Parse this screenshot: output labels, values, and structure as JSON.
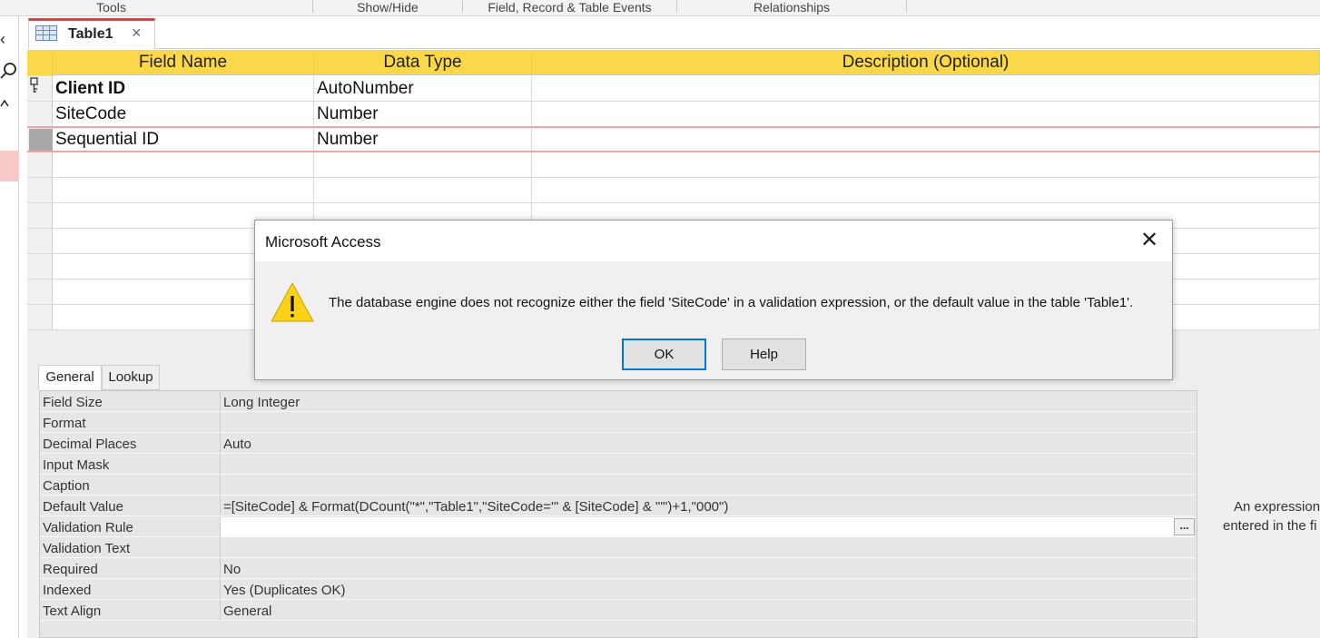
{
  "ribbon": {
    "groups": [
      "Tools",
      "Show/Hide",
      "Field, Record & Table Events",
      "Relationships"
    ]
  },
  "document_tab": {
    "label": "Table1",
    "close": "×"
  },
  "grid": {
    "headers": [
      "Field Name",
      "Data Type",
      "Description (Optional)"
    ],
    "rows": [
      {
        "field": "Client ID",
        "type": "AutoNumber",
        "description": "",
        "primary_key": true
      },
      {
        "field": "SiteCode",
        "type": "Number",
        "description": ""
      },
      {
        "field": "Sequential ID",
        "type": "Number",
        "description": "",
        "selected": true
      }
    ]
  },
  "properties": {
    "tabs": [
      "General",
      "Lookup"
    ],
    "active_tab": "General",
    "rows": [
      {
        "label": "Field Size",
        "value": "Long Integer"
      },
      {
        "label": "Format",
        "value": ""
      },
      {
        "label": "Decimal Places",
        "value": "Auto"
      },
      {
        "label": "Input Mask",
        "value": ""
      },
      {
        "label": "Caption",
        "value": ""
      },
      {
        "label": "Default Value",
        "value": "=[SiteCode] & Format(DCount(\"*\",\"Table1\",\"SiteCode='\" & [SiteCode] & \"'\")+1,\"000\")"
      },
      {
        "label": "Validation Rule",
        "value": ""
      },
      {
        "label": "Validation Text",
        "value": ""
      },
      {
        "label": "Required",
        "value": "No"
      },
      {
        "label": "Indexed",
        "value": "Yes (Duplicates OK)"
      },
      {
        "label": "Text Align",
        "value": "General"
      }
    ],
    "builder_button": "...",
    "help_text_line1": "An expression",
    "help_text_line2": "entered in the fi"
  },
  "dialog": {
    "title": "Microsoft Access",
    "message": "The database engine does not recognize either the field 'SiteCode' in a validation expression, or the default value in the table 'Table1'.",
    "ok_label": "OK",
    "help_label": "Help",
    "close": "✕"
  },
  "colors": {
    "header_yellow": "#fbd84a",
    "tab_accent_red": "#c0504d",
    "primary_button_border": "#0078d7",
    "warning_yellow": "#fcd116"
  }
}
